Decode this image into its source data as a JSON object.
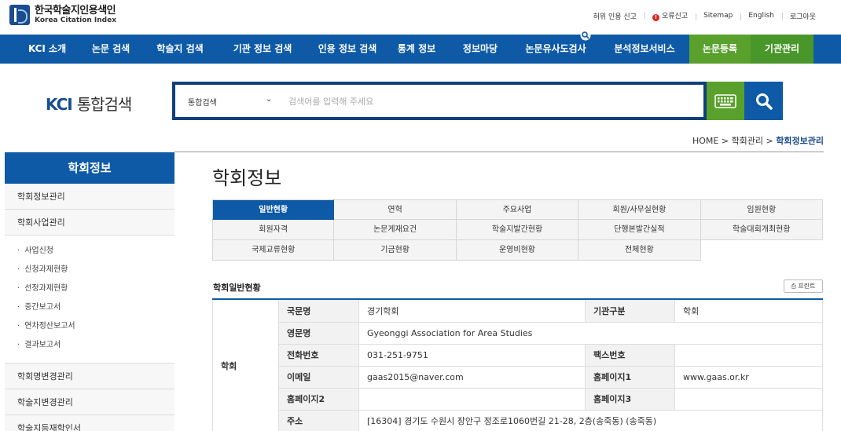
{
  "header": {
    "logo_ko": "한국학술지인용색인",
    "logo_en": "Korea Citation Index",
    "util": [
      "허위 인용 신고",
      "오류신고",
      "Sitemap",
      "English",
      "로그아웃"
    ]
  },
  "gnb": [
    {
      "label": "KCI 소개"
    },
    {
      "label": "논문 검색"
    },
    {
      "label": "학술지 검색"
    },
    {
      "label": "기관 정보 검색"
    },
    {
      "label": "인용 정보 검색"
    },
    {
      "label": "통계 정보"
    },
    {
      "label": "정보마당"
    },
    {
      "label": "논문유사도검사"
    },
    {
      "label": "분석정보서비스"
    },
    {
      "label": "논문등록"
    },
    {
      "label": "기관관리"
    }
  ],
  "search": {
    "logo_a": "KCI",
    "logo_b": "통합검색",
    "scope": "통합검색",
    "placeholder": "검색어를 입력해 주세요"
  },
  "breadcrumb": {
    "home": "HOME",
    "mid": "학회관리",
    "current": "학회정보관리"
  },
  "sidebar": {
    "title": "학회정보",
    "items_top": [
      "학회정보관리",
      "학회사업관리"
    ],
    "sub": [
      "사업신청",
      "신청과제현황",
      "선정과제현황",
      "중간보고서",
      "연차정산보고서",
      "결과보고서"
    ],
    "items_bottom": [
      "학회명변경관리",
      "학술지변경관리",
      "학술지등재학인서"
    ]
  },
  "main": {
    "title": "학회정보",
    "tabs": [
      "일반현황",
      "연혁",
      "주요사업",
      "회원/사무실현황",
      "임원현황",
      "회원자격",
      "논문게재요건",
      "학술지발간현황",
      "단행본발간실적",
      "학술대회개최현황",
      "국제교류현황",
      "기금현황",
      "운영비현황",
      "전체현황"
    ],
    "section_title": "학회일반현황",
    "print_label": "프린트",
    "group_label": "학회",
    "rows": {
      "kor_name_label": "국문명",
      "kor_name": "경기학회",
      "org_type_label": "기관구분",
      "org_type": "학회",
      "eng_name_label": "영문명",
      "eng_name": "Gyeonggi Association for Area Studies",
      "phone_label": "전화번호",
      "phone": "031-251-9751",
      "fax_label": "팩스번호",
      "fax": "",
      "email_label": "이메일",
      "email": "gaas2015@naver.com",
      "hp1_label": "홈페이지1",
      "hp1": "www.gaas.or.kr",
      "hp2_label": "홈페이지2",
      "hp2": "",
      "hp3_label": "홈페이지3",
      "hp3": "",
      "addr_label": "주소",
      "addr": "[16304] 경기도 수원시 장안구 정조로1060번길 21-28, 2층(송죽동) (송죽동)"
    }
  },
  "colors": {
    "primary": "#0e5aa7",
    "green": "#5aa02c",
    "dark_navy": "#0f3f7a"
  }
}
